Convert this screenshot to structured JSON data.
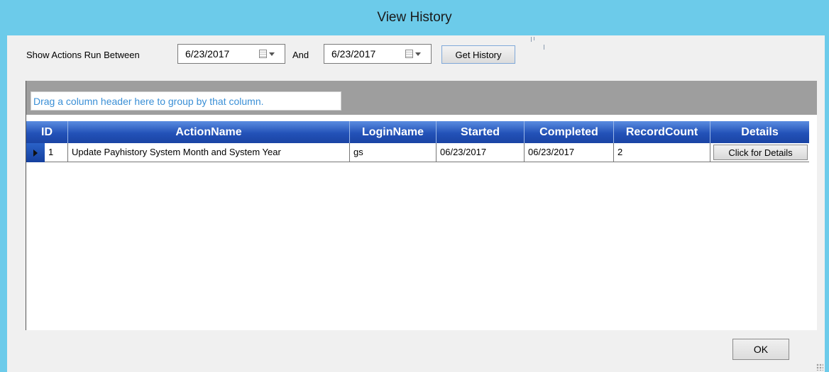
{
  "window": {
    "title": "View History"
  },
  "filter": {
    "show_label": "Show Actions Run Between",
    "from_date": "6/23/2017",
    "and_label": "And",
    "to_date": "6/23/2017",
    "get_history_label": "Get History",
    "calendar_icon": "calendar-icon",
    "dropdown_icon": "chevron-down-icon"
  },
  "grid": {
    "group_hint": "Drag a column header here to group by that column.",
    "columns": [
      "ID",
      "ActionName",
      "LoginName",
      "Started",
      "Completed",
      "RecordCount",
      "Details"
    ],
    "rows": [
      {
        "id": "1",
        "action_name": "Update Payhistory System Month and System Year",
        "login_name": "gs",
        "started": "06/23/2017",
        "completed": "06/23/2017",
        "record_count": "2",
        "details_label": "Click for Details"
      }
    ],
    "header_color": "#2352b8",
    "group_panel_color": "#9e9e9e"
  },
  "footer": {
    "ok_label": "OK"
  },
  "colors": {
    "titlebar": "#6ccbea",
    "client": "#f0f0f0",
    "hint_text": "#3a8fd6"
  }
}
